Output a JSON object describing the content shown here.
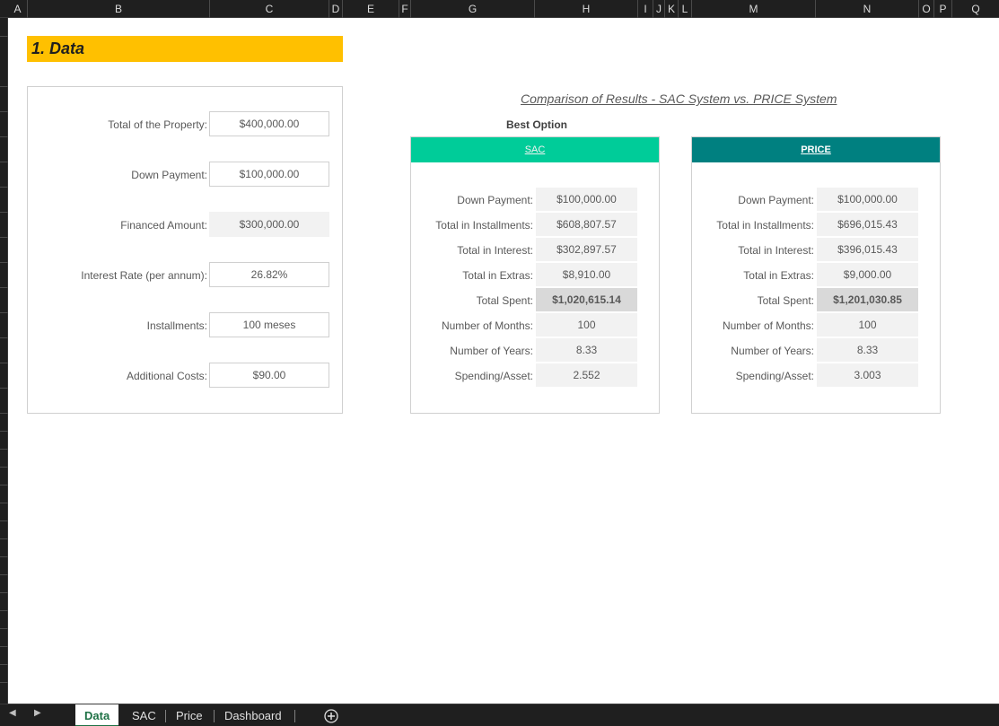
{
  "columns": [
    "A",
    "B",
    "C",
    "D",
    "E",
    "F",
    "G",
    "H",
    "I",
    "J",
    "K",
    "L",
    "M",
    "N",
    "O",
    "P",
    "Q"
  ],
  "title": "1. Data",
  "inputs": [
    {
      "label": "Total of the Property:",
      "value": "$400,000.00",
      "style": "box"
    },
    {
      "label": "Down Payment:",
      "value": "$100,000.00",
      "style": "box"
    },
    {
      "label": "Financed Amount:",
      "value": "$300,000.00",
      "style": "grey"
    },
    {
      "label": "Interest Rate (per annum):",
      "value": "26.82%",
      "style": "box"
    },
    {
      "label": "Installments:",
      "value": "100 meses",
      "style": "box"
    },
    {
      "label": "Additional Costs:",
      "value": "$90.00",
      "style": "box"
    }
  ],
  "comparison": {
    "title": "Comparison of Results - SAC System vs. PRICE System",
    "best_label": "Best Option",
    "systems": [
      {
        "name": "SAC",
        "header_bg": "#00cc99",
        "header_fg": "#f2f2f2",
        "rows": [
          {
            "label": "Down Payment:",
            "value": "$100,000.00"
          },
          {
            "label": "Total in Installments:",
            "value": "$608,807.57"
          },
          {
            "label": "Total in Interest:",
            "value": "$302,897.57"
          },
          {
            "label": "Total in Extras:",
            "value": "$8,910.00"
          },
          {
            "label": "Total Spent:",
            "value": "$1,020,615.14"
          },
          {
            "label": "Number of Months:",
            "value": "100"
          },
          {
            "label": "Number of Years:",
            "value": "8.33"
          },
          {
            "label": "Spending/Asset:",
            "value": "2.552"
          }
        ]
      },
      {
        "name": "PRICE",
        "header_bg": "#008080",
        "header_fg": "#ffffff",
        "rows": [
          {
            "label": "Down Payment:",
            "value": "$100,000.00"
          },
          {
            "label": "Total in Installments:",
            "value": "$696,015.43"
          },
          {
            "label": "Total in Interest:",
            "value": "$396,015.43"
          },
          {
            "label": "Total in Extras:",
            "value": "$9,000.00"
          },
          {
            "label": "Total Spent:",
            "value": "$1,201,030.85"
          },
          {
            "label": "Number of Months:",
            "value": "100"
          },
          {
            "label": "Number of Years:",
            "value": "8.33"
          },
          {
            "label": "Spending/Asset:",
            "value": "3.003"
          }
        ]
      }
    ]
  },
  "sheet_tabs": [
    {
      "label": "Data",
      "active": true
    },
    {
      "label": "SAC",
      "active": false
    },
    {
      "label": "Price",
      "active": false
    },
    {
      "label": "Dashboard",
      "active": false
    }
  ],
  "icons": {
    "prev": "prev-sheet-icon",
    "next": "next-sheet-icon",
    "add": "add-sheet-icon"
  },
  "colors": {
    "title_band": "#ffc000",
    "accent_tab": "#1e7145"
  }
}
